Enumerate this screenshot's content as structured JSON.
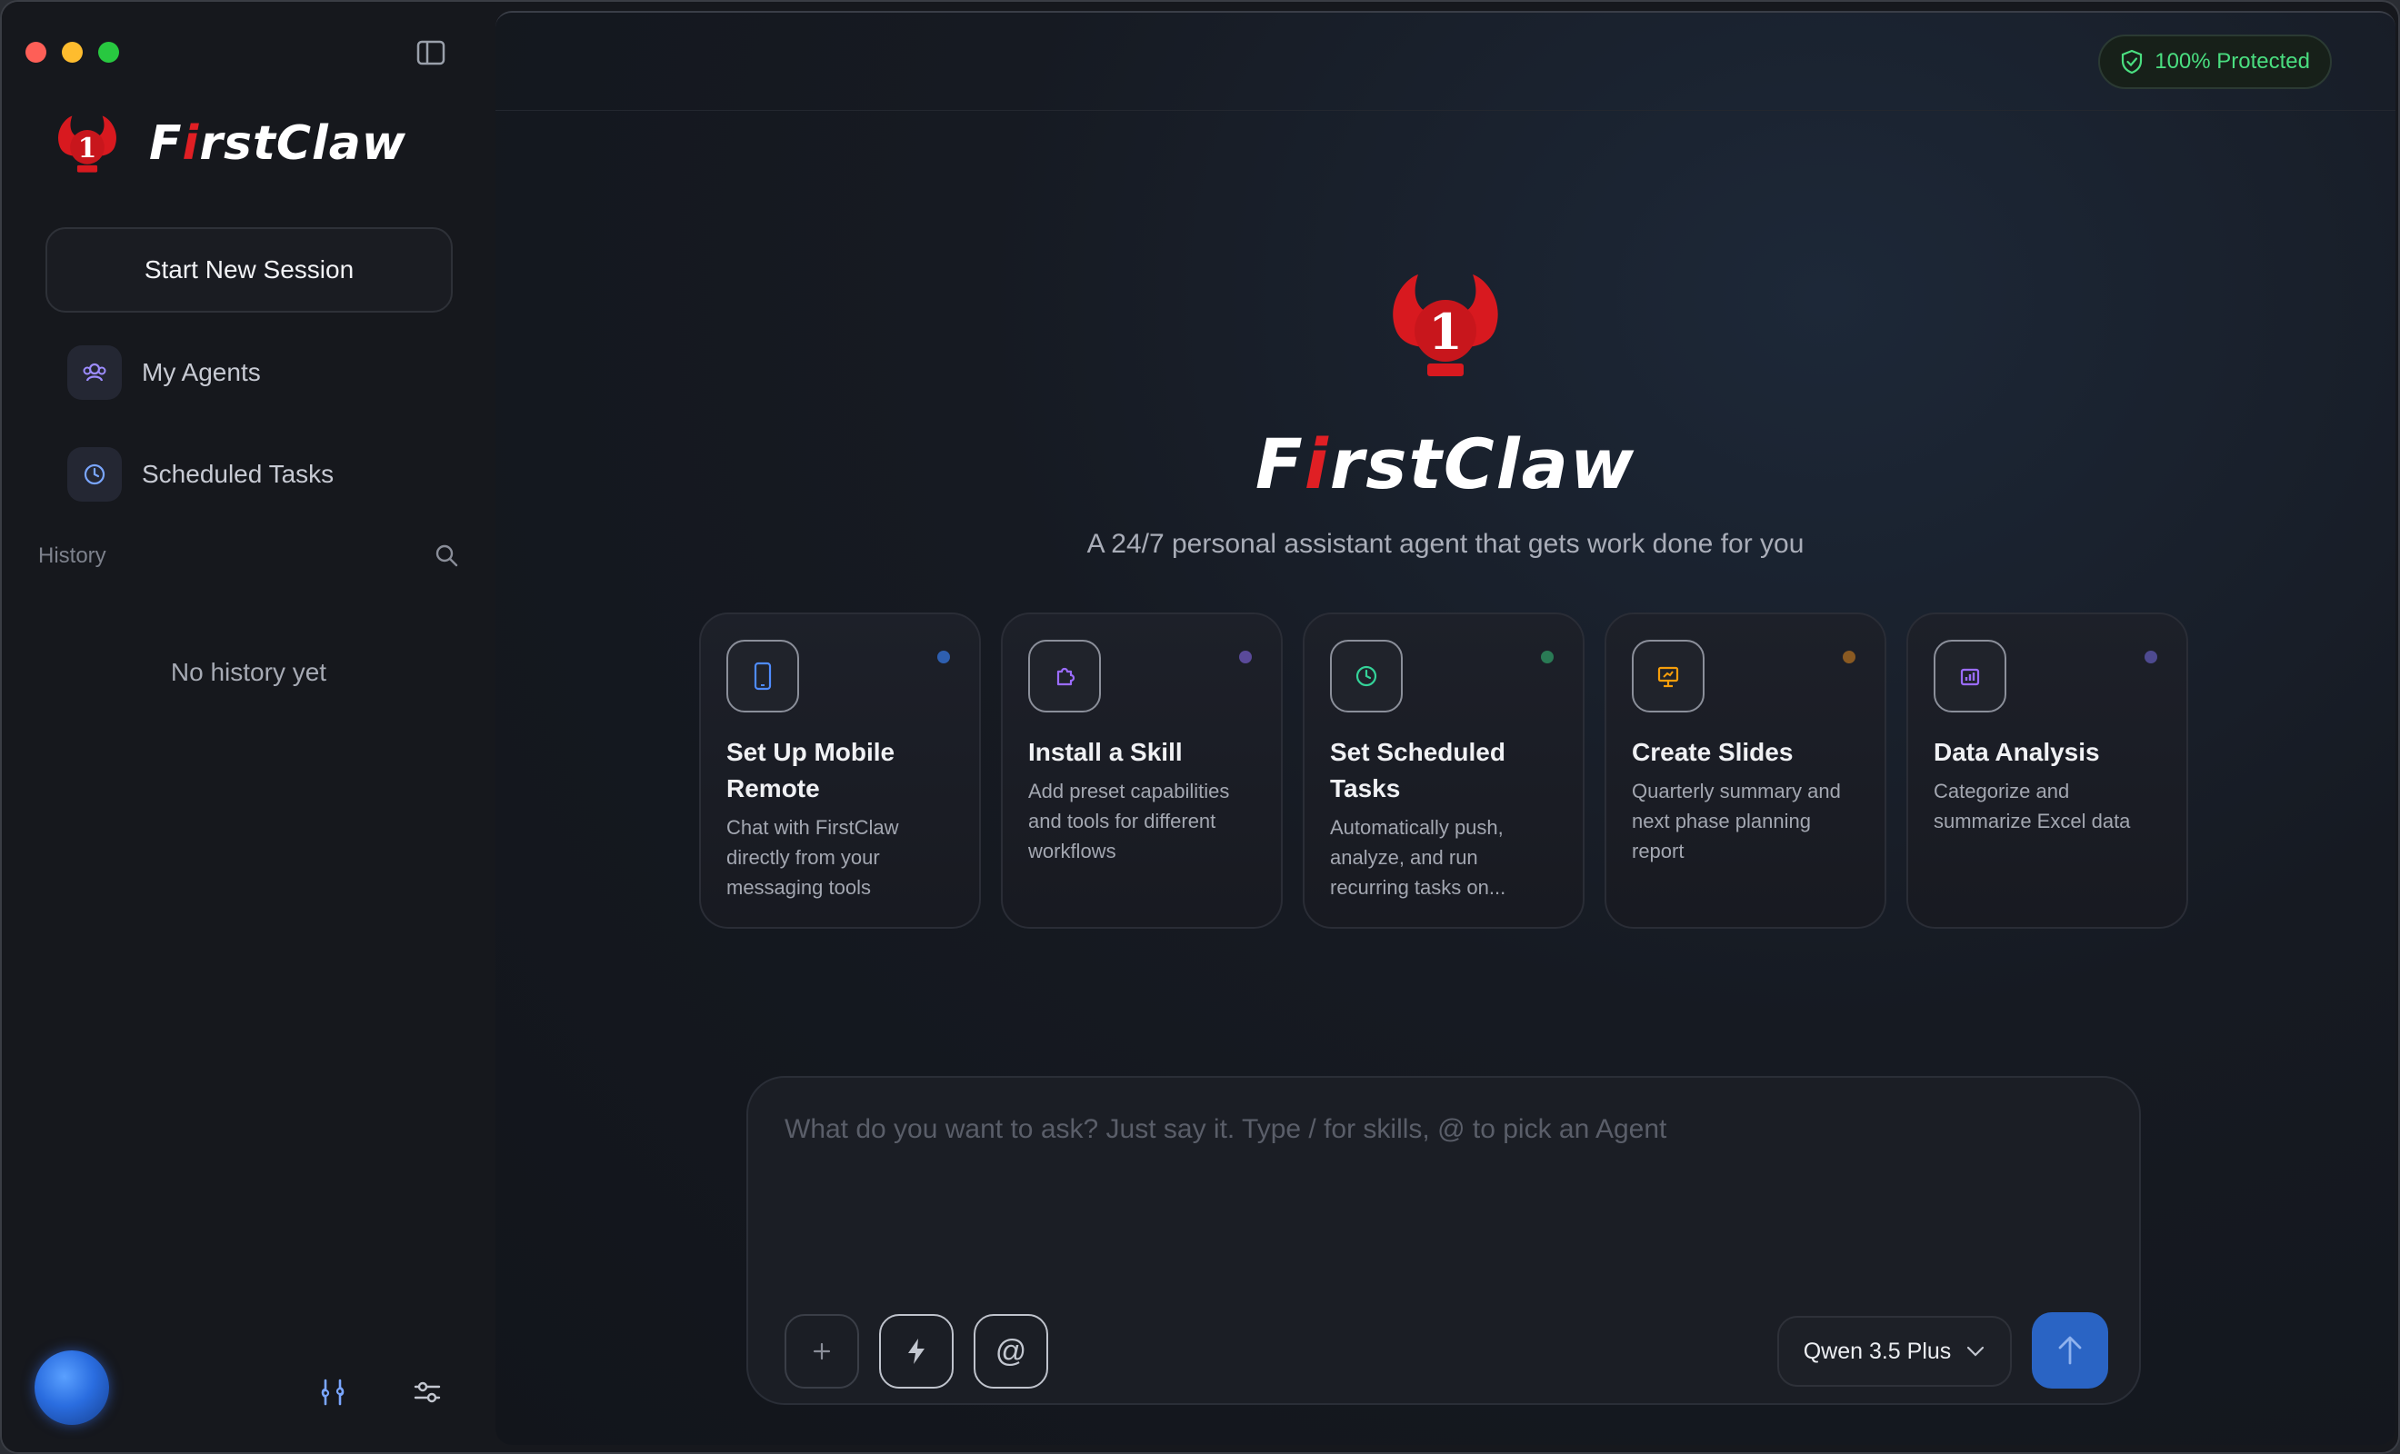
{
  "app": {
    "brand_prefix": "F",
    "brand_i": "i",
    "brand_suffix": "rstClaw"
  },
  "sidebar": {
    "new_session_label": "Start New Session",
    "items": [
      {
        "label": "My Agents",
        "icon": "agents-icon"
      },
      {
        "label": "Scheduled Tasks",
        "icon": "clock-icon"
      }
    ],
    "history_label": "History",
    "empty_history": "No history yet"
  },
  "status": {
    "protected_label": "100% Protected",
    "color": "#4ade80"
  },
  "hero": {
    "tagline": "A 24/7 personal assistant agent that gets work done for you"
  },
  "cards": [
    {
      "title": "Set Up Mobile Remote",
      "desc": "Chat with FirstClaw directly from your messaging tools",
      "icon": "mobile-icon",
      "accent": "#4f8cff",
      "dot": "#2e5fb0"
    },
    {
      "title": "Install a Skill",
      "desc": "Add preset capabilities and tools for different workflows",
      "icon": "puzzle-icon",
      "accent": "#9b6cff",
      "dot": "#5a4a9a"
    },
    {
      "title": "Set Scheduled Tasks",
      "desc": "Automatically push, analyze, and run recurring tasks on...",
      "icon": "clock-icon",
      "accent": "#34d399",
      "dot": "#2a7a55"
    },
    {
      "title": "Create Slides",
      "desc": "Quarterly summary and next phase planning report",
      "icon": "presentation-icon",
      "accent": "#f59e0b",
      "dot": "#8a5a22"
    },
    {
      "title": "Data Analysis",
      "desc": "Categorize and summarize Excel data",
      "icon": "bar-chart-icon",
      "accent": "#9b6cff",
      "dot": "#4e4a90"
    }
  ],
  "composer": {
    "placeholder": "What do you want to ask? Just say it. Type / for skills, @ to pick an Agent",
    "at_symbol": "@",
    "model_label": "Qwen 3.5 Plus"
  }
}
